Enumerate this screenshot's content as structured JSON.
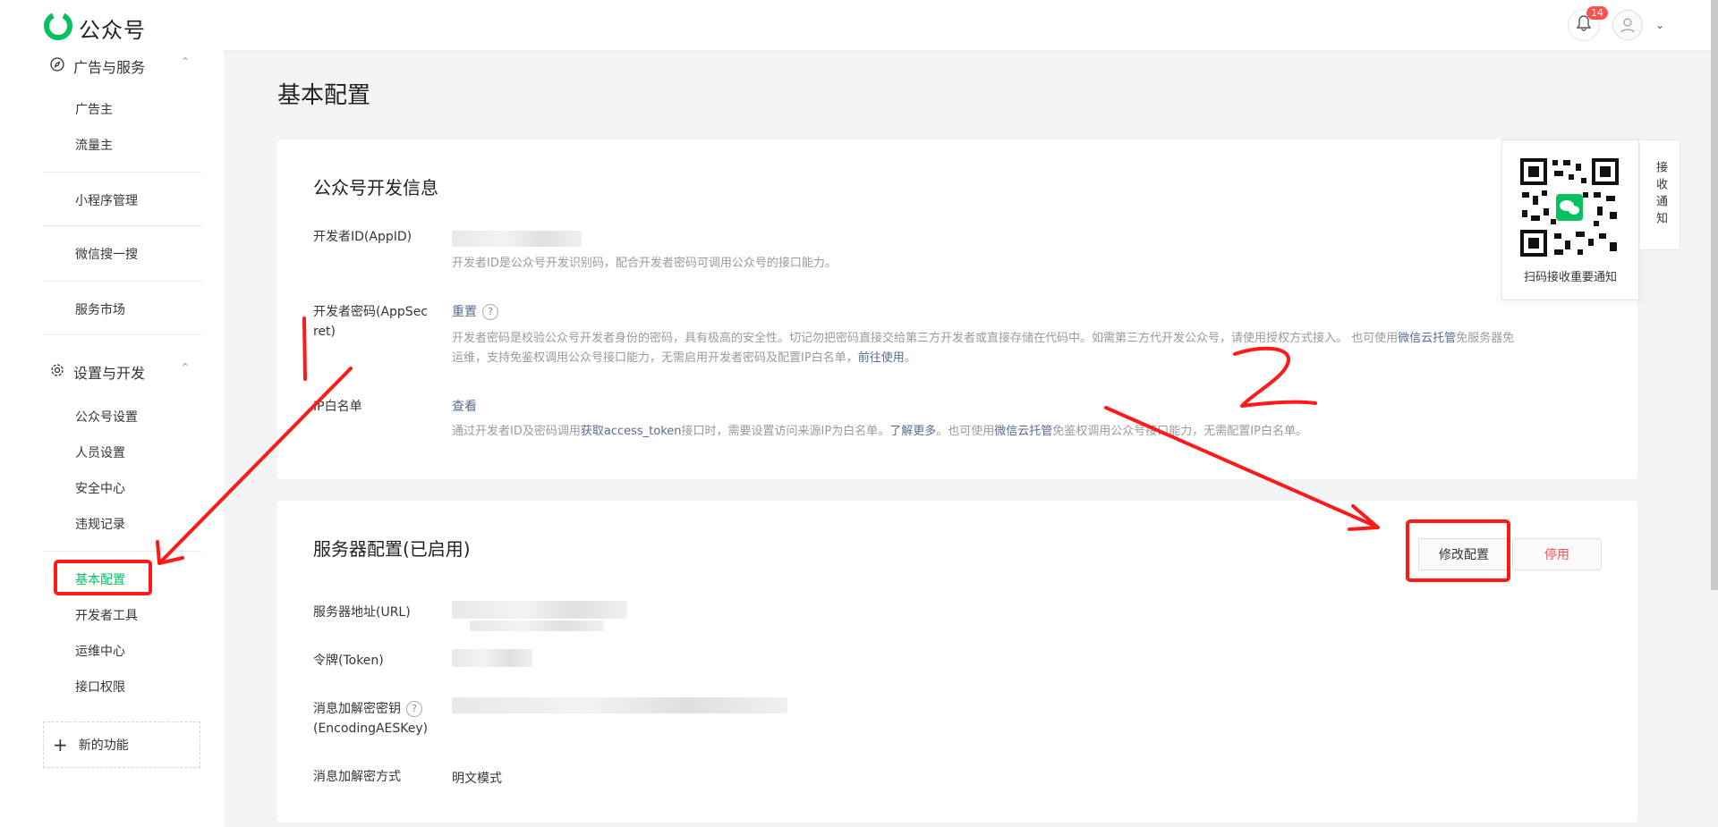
{
  "app": {
    "name": "公众号"
  },
  "header": {
    "notification_count": "14"
  },
  "sidebar": {
    "group_ads": "广告与服务",
    "ads_items": [
      "广告主",
      "流量主"
    ],
    "mini_program": "小程序管理",
    "wechat_search": "微信搜一搜",
    "service_market": "服务市场",
    "group_settings": "设置与开发",
    "settings_items": [
      "公众号设置",
      "人员设置",
      "安全中心",
      "违规记录"
    ],
    "dev_items": [
      "基本配置",
      "开发者工具",
      "运维中心",
      "接口权限"
    ],
    "new_feature": "新的功能"
  },
  "page": {
    "title": "基本配置"
  },
  "dev_info": {
    "title": "公众号开发信息",
    "appid_label": "开发者ID(AppID)",
    "appid_desc": "开发者ID是公众号开发识别码，配合开发者密码可调用公众号的接口能力。",
    "secret_label_1": "开发者密码(AppSec",
    "secret_label_2": "ret)",
    "reset_link": "重置",
    "secret_desc_1a": "开发者密码是校验公众号开发者身份的密码，具有极高的安全性。切记勿把密码直接交给第三方开发者或直接存储在代码中。如需第三方代开发公众号，请使用授权方式接入。 也可使用",
    "secret_desc_1b": "微信云托管",
    "secret_desc_1c": "免服务器免",
    "secret_desc_2a": "运维，支持免鉴权调用公众号接口能力，无需启用开发者密码及配置IP白名单，",
    "secret_desc_2b": "前往使用",
    "secret_desc_2c": "。",
    "ip_label": "IP白名单",
    "ip_view": "查看",
    "ip_desc_a": "通过开发者ID及密码调用",
    "ip_desc_b": "获取access_token",
    "ip_desc_c": "接口时，需要设置访问来源IP为白名单。",
    "ip_desc_d": "了解更多",
    "ip_desc_e": "。也可使用",
    "ip_desc_f": "微信云托管",
    "ip_desc_g": "免鉴权调用公众号接口能力，无需配置IP白名单。"
  },
  "server": {
    "title": "服务器配置(已启用)",
    "modify_button": "修改配置",
    "stop_button": "停用",
    "url_label": "服务器地址(URL)",
    "token_label": "令牌(Token)",
    "aes_label_1": "消息加解密密钥",
    "aes_label_2": "(EncodingAESKey)",
    "mode_label": "消息加解密方式",
    "mode_value": "明文模式"
  },
  "qr": {
    "caption": "扫码接收重要通知",
    "side_label": "接收通知"
  },
  "colors": {
    "brand_green": "#07c160",
    "link": "#576b95",
    "danger": "#fa5151",
    "annotation_red": "#ff1a1a"
  }
}
